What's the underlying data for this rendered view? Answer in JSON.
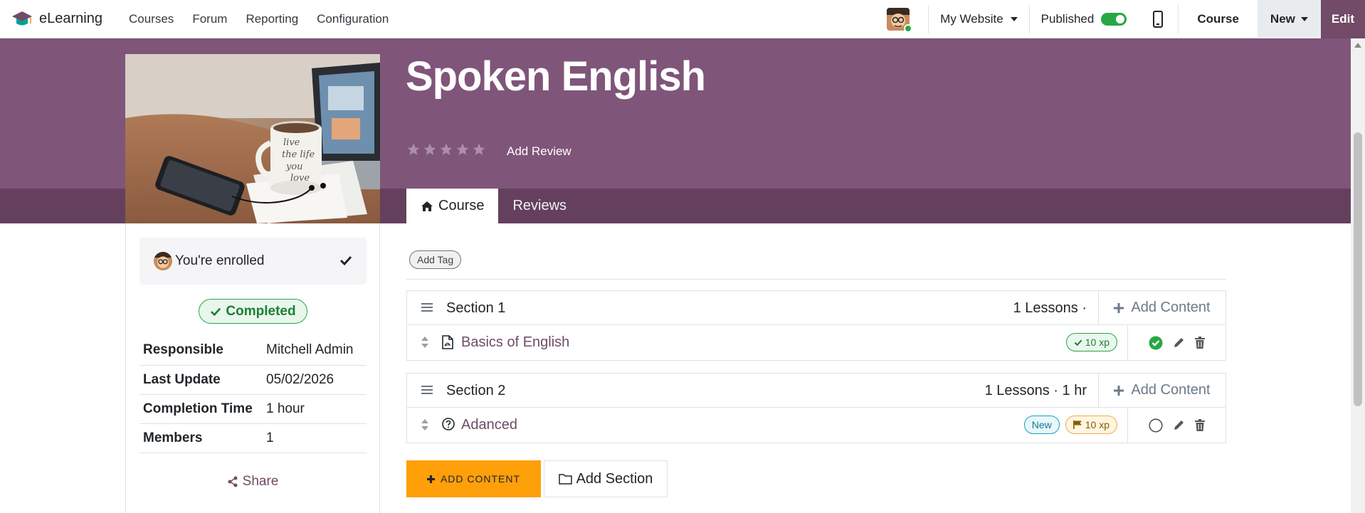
{
  "navbar": {
    "app_name": "eLearning",
    "menu": [
      "Courses",
      "Forum",
      "Reporting",
      "Configuration"
    ],
    "website_label": "My Website",
    "published_label": "Published",
    "published_on": true,
    "course_label": "Course",
    "new_label": "New",
    "edit_label": "Edit"
  },
  "header": {
    "title": "Spoken English",
    "rating_stars": 5,
    "rating_value": 0,
    "add_review": "Add Review",
    "tabs": [
      {
        "label": "Course",
        "icon": "home-icon",
        "active": true
      },
      {
        "label": "Reviews",
        "active": false
      }
    ]
  },
  "sidebar": {
    "enrolled_text": "You're enrolled",
    "completed_label": "Completed",
    "info": [
      {
        "key": "Responsible",
        "value": "Mitchell Admin"
      },
      {
        "key": "Last Update",
        "value": "05/02/2026"
      },
      {
        "key": "Completion Time",
        "value": "1 hour"
      },
      {
        "key": "Members",
        "value": "1"
      }
    ],
    "share_label": "Share"
  },
  "content": {
    "add_tag": "Add Tag",
    "sections": [
      {
        "title": "Section 1",
        "meta": "1 Lessons ·",
        "add_content": "Add Content",
        "lessons": [
          {
            "title": "Basics of English",
            "icon": "pdf-file-icon",
            "new_badge": "",
            "xp": "10 xp",
            "completed": true
          }
        ]
      },
      {
        "title": "Section 2",
        "meta": "1 Lessons · 1 hr",
        "add_content": "Add Content",
        "lessons": [
          {
            "title": "Adanced",
            "icon": "question-circle-icon",
            "new_badge": "New",
            "xp": "10 xp",
            "completed": false
          }
        ]
      }
    ],
    "add_content_button": "ADD CONTENT",
    "add_section_button": "Add Section"
  },
  "colors": {
    "brand": "#714b67",
    "banner": "#7f5579",
    "banner_strip": "#64405e",
    "success": "#28a745",
    "accent_orange": "#ff9f0a"
  }
}
